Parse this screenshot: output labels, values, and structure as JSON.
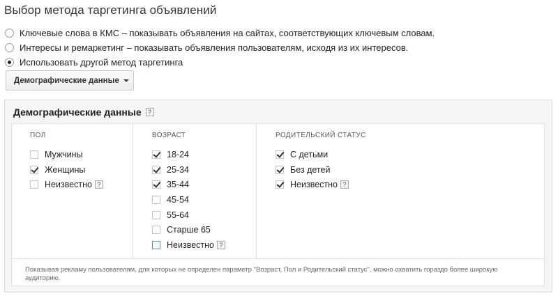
{
  "page": {
    "title": "Выбор метода таргетинга объявлений"
  },
  "targeting_options": [
    {
      "label": "Ключевые слова в КМС – показывать объявления на сайтах, соответствующих ключевым словам.",
      "selected": false
    },
    {
      "label": "Интересы и ремаркетинг – показывать объявления пользователям, исходя из их интересов.",
      "selected": false
    },
    {
      "label": "Использовать другой метод таргетинга",
      "selected": true
    }
  ],
  "method_dropdown": {
    "label": "Демографические данные"
  },
  "panel": {
    "title": "Демографические данные",
    "help_glyph": "?",
    "columns": [
      {
        "header": "ПОЛ",
        "options": [
          {
            "label": "Мужчины",
            "checked": false,
            "help": false
          },
          {
            "label": "Женщины",
            "checked": true,
            "help": false
          },
          {
            "label": "Неизвестно",
            "checked": false,
            "help": true
          }
        ]
      },
      {
        "header": "ВОЗРАСТ",
        "options": [
          {
            "label": "18-24",
            "checked": true,
            "help": false
          },
          {
            "label": "25-34",
            "checked": true,
            "help": false
          },
          {
            "label": "35-44",
            "checked": true,
            "help": false
          },
          {
            "label": "45-54",
            "checked": false,
            "help": false
          },
          {
            "label": "55-64",
            "checked": false,
            "help": false
          },
          {
            "label": "Старше 65",
            "checked": false,
            "help": false
          },
          {
            "label": "Неизвестно",
            "checked": false,
            "help": true
          }
        ]
      },
      {
        "header": "РОДИТЕЛЬСКИЙ СТАТУС",
        "options": [
          {
            "label": "С детьми",
            "checked": true,
            "help": false
          },
          {
            "label": "Без детей",
            "checked": true,
            "help": false
          },
          {
            "label": "Неизвестно",
            "checked": true,
            "help": true
          }
        ]
      }
    ],
    "note": "Показывая рекламу пользователям, для которых не определен параметр \"Возраст, Пол и Родительский статус\", можно охватить гораздо более широкую аудиторию."
  }
}
